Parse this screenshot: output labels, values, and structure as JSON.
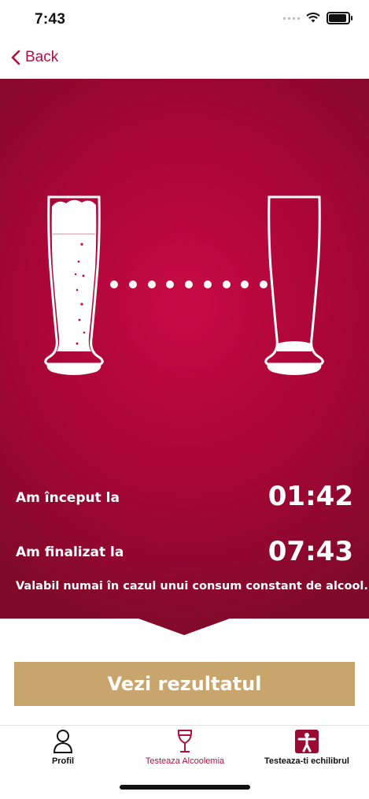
{
  "status_bar": {
    "time": "7:43"
  },
  "nav": {
    "back_label": "Back"
  },
  "session": {
    "start_label": "Am început la",
    "start_time": "01:42",
    "end_label": "Am finalizat la",
    "end_time": "07:43",
    "disclaimer": "Valabil numai în cazul unui consum constant de alcool."
  },
  "actions": {
    "result_button": "Vezi rezultatul"
  },
  "tabs": [
    {
      "label": "Profil",
      "icon": "person-icon",
      "active": false
    },
    {
      "label": "Testeaza Alcoolemia",
      "icon": "wine-glass-icon",
      "active": true
    },
    {
      "label": "Testeaza-ti echilibrul",
      "icon": "balance-icon",
      "active": false
    }
  ],
  "colors": {
    "accent": "#b01040",
    "hero": "#a60636",
    "button": "#c9a56e"
  }
}
